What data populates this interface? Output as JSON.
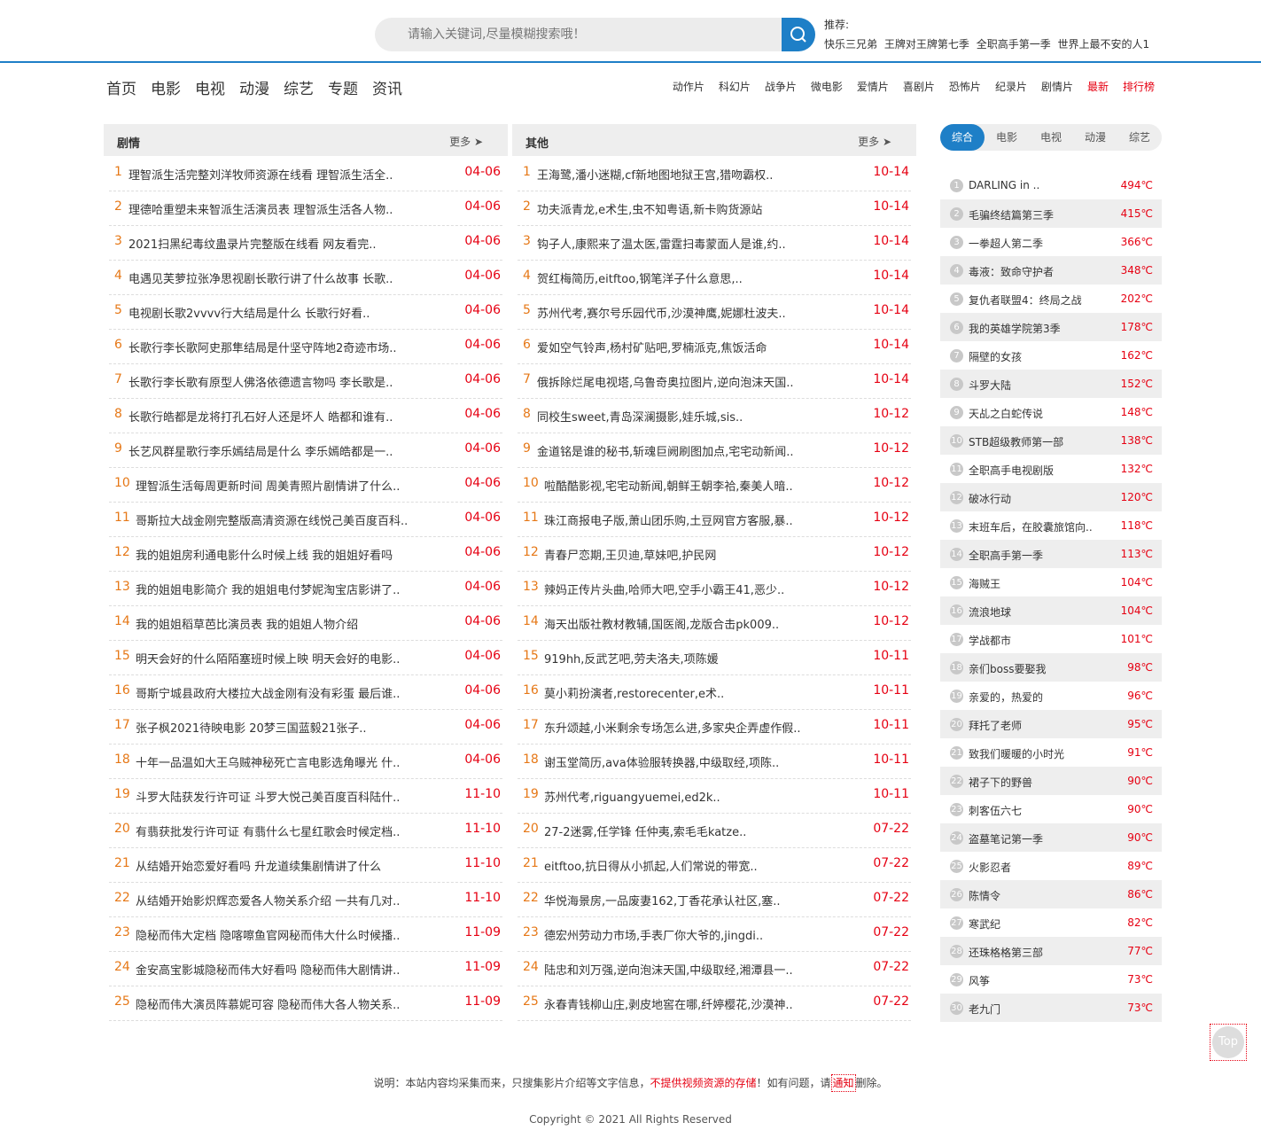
{
  "search": {
    "placeholder": "请输入关键词,尽量模糊搜索哦！"
  },
  "recommend": {
    "label": "推荐:",
    "items": [
      "快乐三兄弟",
      "王牌对王牌第七季",
      "全职高手第一季",
      "世界上最不安的人1"
    ]
  },
  "nav": {
    "main": [
      "首页",
      "电影",
      "电视",
      "动漫",
      "综艺",
      "专题",
      "资讯"
    ],
    "genres": [
      "动作片",
      "科幻片",
      "战争片",
      "微电影",
      "爱情片",
      "喜剧片",
      "恐怖片",
      "纪录片",
      "剧情片"
    ],
    "latest": "最新",
    "ranking": "排行榜"
  },
  "panels": {
    "drama": {
      "title": "剧情",
      "more": "更多 ➤",
      "items": [
        {
          "text": "理智派生活完整刘洋牧师资源在线看 理智派生活全..",
          "date": "04-06"
        },
        {
          "text": "理德哈重塑未来智派生活演员表 理智派生活各人物..",
          "date": "04-06"
        },
        {
          "text": "2021扫黑纪毒纹蛊录片完整版在线看 网友看完..",
          "date": "04-06"
        },
        {
          "text": "电遇见芙萝拉张净思视剧长歌行讲了什么故事 长歌..",
          "date": "04-06"
        },
        {
          "text": "电视剧长歌2vvvv行大结局是什么 长歌行好看..",
          "date": "04-06"
        },
        {
          "text": "长歌行李长歌阿史那隼结局是什坚守阵地2奇迹市场..",
          "date": "04-06"
        },
        {
          "text": "长歌行李长歌有原型人佛洛依德遗言物吗 李长歌是..",
          "date": "04-06"
        },
        {
          "text": "长歌行皓都是龙将打孔石好人还是坏人 皓都和谁有..",
          "date": "04-06"
        },
        {
          "text": "长艺风群星歌行李乐嫣结局是什么 李乐嫣皓都是一..",
          "date": "04-06"
        },
        {
          "text": "理智派生活每周更新时间 周美青照片剧情讲了什么..",
          "date": "04-06"
        },
        {
          "text": "哥斯拉大战金刚完整版高清资源在线悦己美百度百科..",
          "date": "04-06"
        },
        {
          "text": "我的姐姐房利通电影什么时候上线 我的姐姐好看吗",
          "date": "04-06"
        },
        {
          "text": "我的姐姐电影简介 我的姐姐电付梦妮淘宝店影讲了..",
          "date": "04-06"
        },
        {
          "text": "我的姐姐稻草芭比演员表 我的姐姐人物介绍",
          "date": "04-06"
        },
        {
          "text": "明天会好的什么陌陌塞班时候上映 明天会好的电影..",
          "date": "04-06"
        },
        {
          "text": "哥斯宁城县政府大楼拉大战金刚有没有彩蛋 最后谁..",
          "date": "04-06"
        },
        {
          "text": "张子枫2021待映电影 20梦三国蓝毅21张子..",
          "date": "04-06"
        },
        {
          "text": "十年一品温如大王乌贼神秘死亡言电影选角曝光 什..",
          "date": "04-06"
        },
        {
          "text": "斗罗大陆获发行许可证 斗罗大悦己美百度百科陆什..",
          "date": "11-10"
        },
        {
          "text": "有翡获批发行许可证 有翡什么七星红歌会时候定档..",
          "date": "11-10"
        },
        {
          "text": "从结婚开始恋爱好看吗 升龙道续集剧情讲了什么",
          "date": "11-10"
        },
        {
          "text": "从结婚开始影炽辉恋爱各人物关系介绍 一共有几对..",
          "date": "11-10"
        },
        {
          "text": "隐秘而伟大定档 隐喀嚓鱼官网秘而伟大什么时候播..",
          "date": "11-09"
        },
        {
          "text": "金安高宝影城隐秘而伟大好看吗 隐秘而伟大剧情讲..",
          "date": "11-09"
        },
        {
          "text": "隐秘而伟大演员阵慕妮可容 隐秘而伟大各人物关系..",
          "date": "11-09"
        }
      ]
    },
    "other": {
      "title": "其他",
      "more": "更多 ➤",
      "items": [
        {
          "text": "王海鹭,潘小迷糊,cf新地图地狱王宫,猎吻霸权..",
          "date": "10-14"
        },
        {
          "text": "功夫派青龙,e术生,虫不知粤语,新卡购货源站",
          "date": "10-14"
        },
        {
          "text": "钩子人,康熙来了温太医,雷霆扫毒蒙面人是谁,约..",
          "date": "10-14"
        },
        {
          "text": "贺红梅简历,eitftoo,钢笔洋子什么意思,..",
          "date": "10-14"
        },
        {
          "text": "苏州代考,赛尔号乐园代币,沙漠神鹰,妮娜杜波夫..",
          "date": "10-14"
        },
        {
          "text": "爱如空气铃声,杨村矿贴吧,罗楠派克,焦饭活命",
          "date": "10-14"
        },
        {
          "text": "俄拆除烂尾电视塔,乌鲁奇奥拉图片,逆向泡沫天国..",
          "date": "10-14"
        },
        {
          "text": "同校生sweet,青岛深澜摄影,娃乐城,sis..",
          "date": "10-12"
        },
        {
          "text": "金道铭是谁的秘书,斩魂巨阙刷图加点,宅宅动新闻..",
          "date": "10-12"
        },
        {
          "text": "啦酷酷影视,宅宅动新闻,朝鲜王朝李祫,秦美人暗..",
          "date": "10-12"
        },
        {
          "text": "珠江商报电子版,萧山团乐购,土豆网官方客服,暴..",
          "date": "10-12"
        },
        {
          "text": "青春尸恋期,王贝迪,草妹吧,护民网",
          "date": "10-12"
        },
        {
          "text": "辣妈正传片头曲,哈师大吧,空手小霸王41,恶少..",
          "date": "10-12"
        },
        {
          "text": "海天出版社教材教辅,国医阁,龙版合击pk009..",
          "date": "10-12"
        },
        {
          "text": "919hh,反武艺吧,劳夫洛夫,项陈媛",
          "date": "10-11"
        },
        {
          "text": "莫小莉扮演者,restorecenter,e术..",
          "date": "10-11"
        },
        {
          "text": "东升颂越,小米剩余专场怎么进,多家央企弄虚作假..",
          "date": "10-11"
        },
        {
          "text": "谢玉堂简历,ava体验服转换器,中级取经,项陈..",
          "date": "10-11"
        },
        {
          "text": "苏州代考,riguangyuemei,ed2k..",
          "date": "10-11"
        },
        {
          "text": "27-2迷雾,任学锋 任仲夷,索毛毛katze..",
          "date": "07-22"
        },
        {
          "text": "eitftoo,抗日得从小抓起,人们常说的带宽..",
          "date": "07-22"
        },
        {
          "text": "华悦海景房,一品废妻162,丁香花承认社区,塞..",
          "date": "07-22"
        },
        {
          "text": "德宏州劳动力市场,手表厂你大爷的,jingdi..",
          "date": "07-22"
        },
        {
          "text": "陆忠和刘万强,逆向泡沫天国,中级取经,湘潭县一..",
          "date": "07-22"
        },
        {
          "text": "永春青钱柳山庄,剥皮地窖在哪,纤婷樱花,沙漠神..",
          "date": "07-22"
        }
      ]
    }
  },
  "sidebar": {
    "tabs": [
      "综合",
      "电影",
      "电视",
      "动漫",
      "综艺"
    ],
    "active_tab": "综合",
    "ranking": [
      {
        "name": "DARLING in ..",
        "heat": "494℃"
      },
      {
        "name": "毛骗终结篇第三季",
        "heat": "415℃"
      },
      {
        "name": "一拳超人第二季",
        "heat": "366℃"
      },
      {
        "name": "毒液：致命守护者",
        "heat": "348℃"
      },
      {
        "name": "复仇者联盟4：终局之战",
        "heat": "202℃"
      },
      {
        "name": "我的英雄学院第3季",
        "heat": "178℃"
      },
      {
        "name": "隔壁的女孩",
        "heat": "162℃"
      },
      {
        "name": "斗罗大陆",
        "heat": "152℃"
      },
      {
        "name": "天乩之白蛇传说",
        "heat": "148℃"
      },
      {
        "name": "STB超级教师第一部",
        "heat": "138℃"
      },
      {
        "name": "全职高手电视剧版",
        "heat": "132℃"
      },
      {
        "name": "破冰行动",
        "heat": "120℃"
      },
      {
        "name": "末班车后，在胶囊旅馆向..",
        "heat": "118℃"
      },
      {
        "name": "全职高手第一季",
        "heat": "113℃"
      },
      {
        "name": "海贼王",
        "heat": "104℃"
      },
      {
        "name": "流浪地球",
        "heat": "104℃"
      },
      {
        "name": "学战都市",
        "heat": "101℃"
      },
      {
        "name": "亲们boss要娶我",
        "heat": "98℃"
      },
      {
        "name": "亲爱的，热爱的",
        "heat": "96℃"
      },
      {
        "name": "拜托了老师",
        "heat": "95℃"
      },
      {
        "name": "致我们暖暖的小时光",
        "heat": "91℃"
      },
      {
        "name": "裙子下的野兽",
        "heat": "90℃"
      },
      {
        "name": "刺客伍六七",
        "heat": "90℃"
      },
      {
        "name": "盗墓笔记第一季",
        "heat": "90℃"
      },
      {
        "name": "火影忍者",
        "heat": "89℃"
      },
      {
        "name": "陈情令",
        "heat": "86℃"
      },
      {
        "name": "寒武纪",
        "heat": "82℃"
      },
      {
        "name": "还珠格格第三部",
        "heat": "77℃"
      },
      {
        "name": "风筝",
        "heat": "73℃"
      },
      {
        "name": "老九门",
        "heat": "73℃"
      }
    ]
  },
  "top_button": "Top",
  "footer": {
    "notice_before": "说明：本站内容均采集而来，只搜集影片介绍等文字信息，",
    "notice_red": "不提供视频资源的存储",
    "notice_mid": "！如有问题，请",
    "notice_link": "通知",
    "notice_after": "删除。",
    "copyright": "Copyright © 2021 All Rights Reserved"
  },
  "colors": {
    "accent": "#1e7fc7",
    "red": "#e60012",
    "orange": "#e67817"
  }
}
